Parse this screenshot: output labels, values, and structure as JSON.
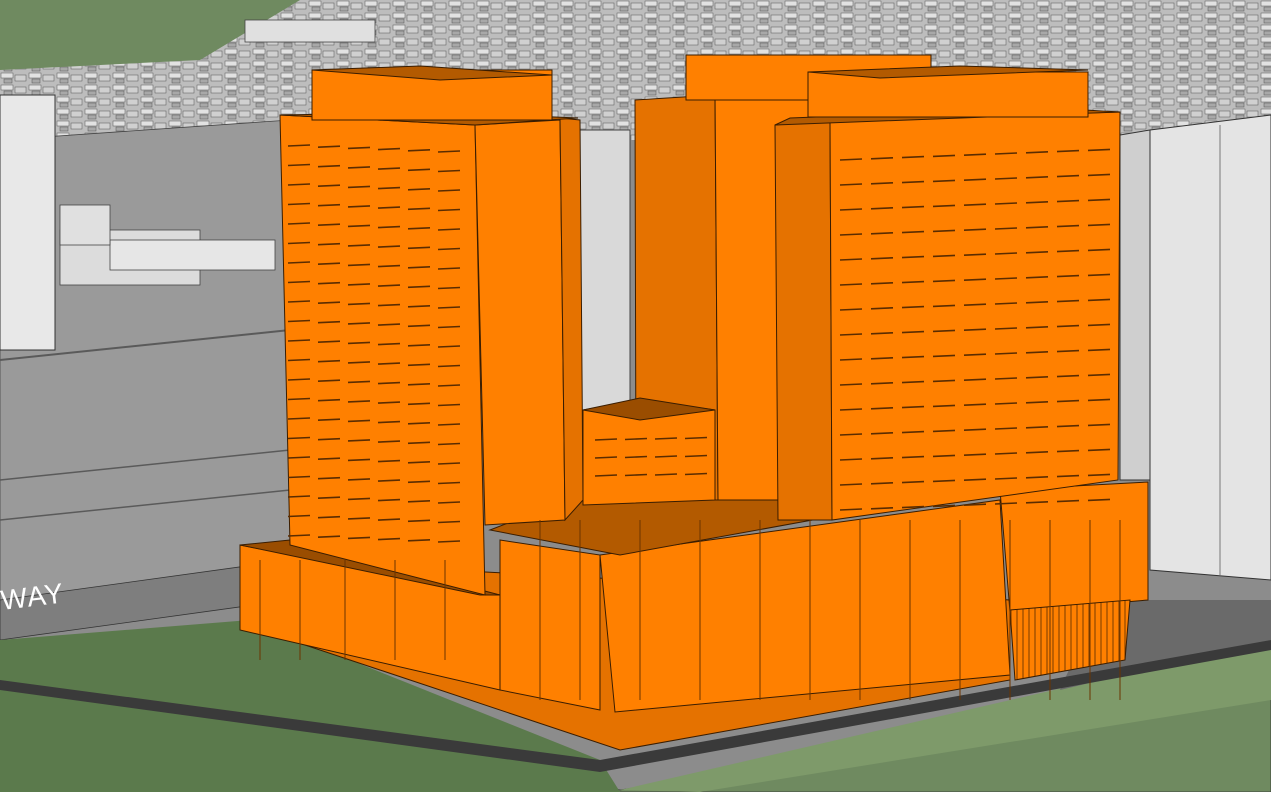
{
  "scene": {
    "road_label": "WAY",
    "colors": {
      "building_main": "#ff8000",
      "building_side": "#e57200",
      "building_roof": "#b35a00",
      "building_shadow": "#9a4d00",
      "context_white": "#e6e6e6",
      "context_grey": "#9b9b9b",
      "ground_grey": "#7d7d7d",
      "grass": "#6e8a5a",
      "edge_lines": "#2a2a2a"
    }
  }
}
